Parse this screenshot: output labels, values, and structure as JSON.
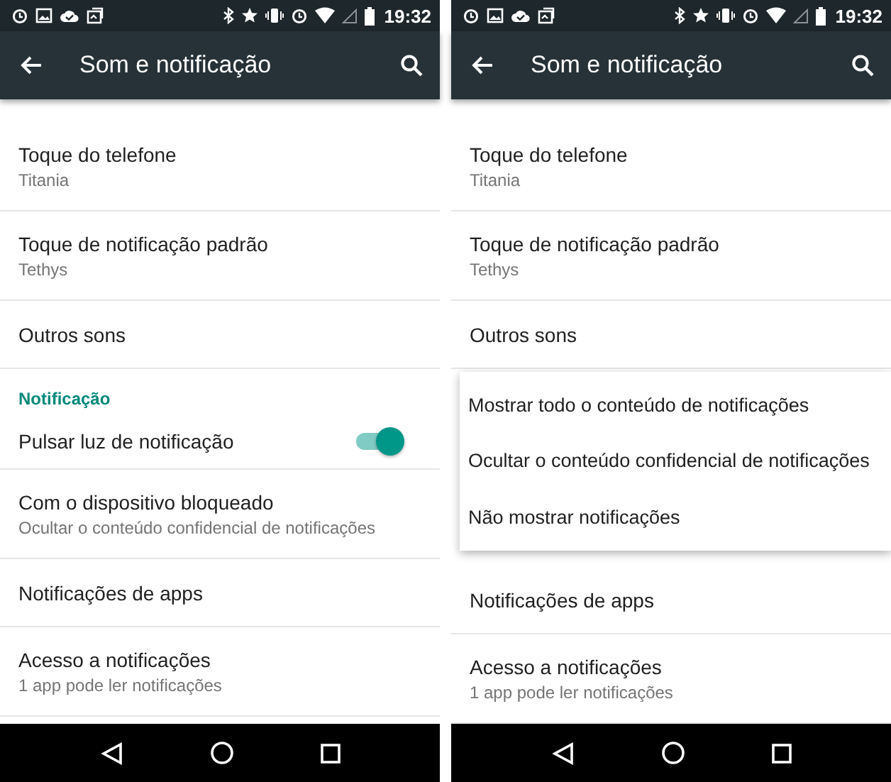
{
  "phones": [
    {
      "status_bar": {
        "time": "19:32"
      },
      "app_bar": {
        "title": "Som e notificação"
      },
      "items": [
        {
          "kind": "setting",
          "title": "Toque do telefone",
          "subtitle": "Titania"
        },
        {
          "kind": "setting",
          "title": "Toque de notificação padrão",
          "subtitle": "Tethys"
        },
        {
          "kind": "setting",
          "title": "Outros sons"
        },
        {
          "kind": "header",
          "title": "Notificação"
        },
        {
          "kind": "switch",
          "title": "Pulsar luz de notificação",
          "on": true
        },
        {
          "kind": "setting",
          "title": "Com o dispositivo bloqueado",
          "subtitle": "Ocultar o conteúdo confidencial de notificações"
        },
        {
          "kind": "setting",
          "title": "Notificações de apps"
        },
        {
          "kind": "setting",
          "title": "Acesso a notificações",
          "subtitle": "1 app pode ler notificações"
        }
      ]
    },
    {
      "status_bar": {
        "time": "19:32"
      },
      "app_bar": {
        "title": "Som e notificação"
      },
      "items": [
        {
          "kind": "setting",
          "title": "Toque do telefone",
          "subtitle": "Titania"
        },
        {
          "kind": "setting",
          "title": "Toque de notificação padrão",
          "subtitle": "Tethys"
        },
        {
          "kind": "setting",
          "title": "Outros sons"
        },
        {
          "kind": "menu",
          "options": [
            "Mostrar todo o conteúdo de notificações",
            "Ocultar o conteúdo confidencial de notificações",
            "Não mostrar notificações"
          ]
        },
        {
          "kind": "setting",
          "title": "Notificações de apps"
        },
        {
          "kind": "setting",
          "title": "Acesso a notificações",
          "subtitle": "1 app pode ler notificações"
        }
      ]
    }
  ]
}
